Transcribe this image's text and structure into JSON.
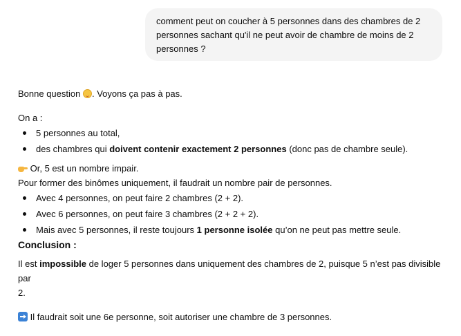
{
  "user_message": {
    "line1": "comment peut on coucher à 5 personnes dans des chambres de 2",
    "line2": "personnes sachant qu'il ne peut avoir de chambre de moins de 2",
    "line3": "personnes ?"
  },
  "answer": {
    "intro_before_emoji": "Bonne question ",
    "intro_emoji": "smiling-face-icon",
    "intro_after_emoji": ". Voyons ça pas à pas.",
    "on_a": "On a :",
    "facts": [
      {
        "text": "5 personnes au total,"
      },
      {
        "before": "des chambres qui ",
        "bold": "doivent contenir exactement 2 personnes",
        "after": " (donc pas de chambre seule)."
      }
    ],
    "point_emoji": "pointing-hand-icon",
    "point_text": "Or, 5 est un nombre impair.",
    "pairs_line": "Pour former des binômes uniquement, il faudrait un nombre pair de personnes.",
    "cases": [
      {
        "text": "Avec 4 personnes, on peut faire 2 chambres (2 + 2)."
      },
      {
        "text": "Avec 6 personnes, on peut faire 3 chambres (2 + 2 + 2)."
      },
      {
        "before": "Mais avec 5 personnes, il reste toujours ",
        "bold": "1 personne isolée",
        "after": " qu’on ne peut pas mettre seule."
      }
    ],
    "conclusion_heading": "Conclusion :",
    "conclusion_before": "Il est ",
    "conclusion_bold": "impossible",
    "conclusion_after_line1": " de loger 5 personnes dans uniquement des chambres de 2, puisque 5 n’est pas divisible par",
    "conclusion_line2": "2.",
    "final_emoji": "right-arrow-icon",
    "final_text": " Il faudrait soit une 6e personne, soit autoriser une chambre de 3 personnes."
  }
}
